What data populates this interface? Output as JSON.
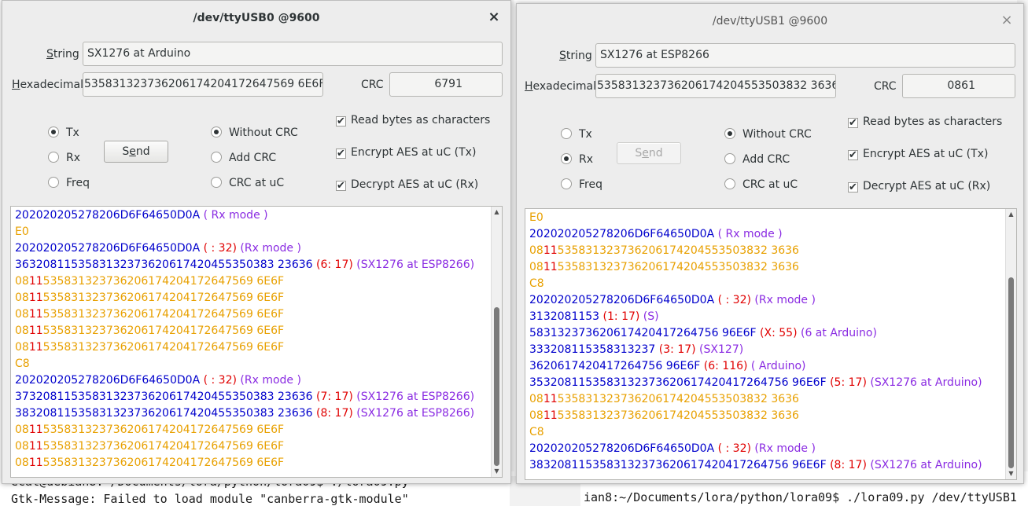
{
  "terminal": {
    "line1": "ecat@debian8:~/Documents/lora/python/lora09$ ./lora09.py",
    "line2": "Gtk-Message: Failed to load module \"canberra-gtk-module\"",
    "line3": "ian8:~/Documents/lora/python/lora09$ ./lora09.py /dev/ttyUSB1"
  },
  "windows": [
    {
      "title": "/dev/ttyUSB0 @9600",
      "close_glyph": "×",
      "string_label_u": "S",
      "string_label_rest": "tring",
      "string_value": "SX1276 at Arduino",
      "hex_label_u": "H",
      "hex_label_rest": "exadecimal",
      "hex_value": "535831323736206174204172647569 6E6F",
      "crc_label": "CRC",
      "crc_value": "6791",
      "radios_mode": [
        "Tx",
        "Rx",
        "Freq"
      ],
      "mode_selected": 0,
      "radios_crc": [
        "Without CRC",
        "Add CRC",
        "CRC at uC"
      ],
      "crc_selected": 0,
      "send_label_u": "e",
      "send_label_pre": "S",
      "send_label_post": "nd",
      "checks": [
        "Read bytes as characters",
        "Encrypt AES at uC (Tx)",
        "Decrypt AES at uC (Rx)"
      ],
      "check_glyph": "✔"
    },
    {
      "title": "/dev/ttyUSB1 @9600",
      "close_glyph": "×",
      "string_label_u": "S",
      "string_label_rest": "tring",
      "string_value": "SX1276 at ESP8266",
      "hex_label_u": "H",
      "hex_label_rest": "exadecimal",
      "hex_value": "535831323736206174204553503832 3636",
      "crc_label": "CRC",
      "crc_value": "0861",
      "radios_mode": [
        "Tx",
        "Rx",
        "Freq"
      ],
      "mode_selected": 1,
      "radios_crc": [
        "Without CRC",
        "Add CRC",
        "CRC at uC"
      ],
      "crc_selected": 0,
      "send_label_u": "e",
      "send_label_pre": "S",
      "send_label_post": "nd",
      "checks": [
        "Read bytes as characters",
        "Encrypt AES at uC (Tx)",
        "Decrypt AES at uC (Rx)"
      ],
      "check_glyph": "✔"
    }
  ],
  "log1": [
    [
      [
        "blue",
        "202020205278206D6F64650D0A"
      ],
      [
        "purple",
        " ( Rx mode )"
      ]
    ],
    [
      [
        "orange",
        "E0"
      ]
    ],
    [
      [
        "blue",
        "202020205278206D6F64650D0A"
      ],
      [
        "red",
        " ( : 32)"
      ],
      [
        "purple",
        " (Rx mode )"
      ]
    ],
    [
      [
        "blue",
        "3632081153583132373620617420455350383 23636"
      ],
      [
        "red",
        " (6: 17)"
      ],
      [
        "purple",
        " (SX1276 at ESP8266)"
      ]
    ],
    [
      [
        "orange",
        "08"
      ],
      [
        "red",
        "11"
      ],
      [
        "orange",
        "535831323736206174204172647569 6E6F"
      ]
    ],
    [
      [
        "orange",
        "08"
      ],
      [
        "red",
        "11"
      ],
      [
        "orange",
        "535831323736206174204172647569 6E6F"
      ]
    ],
    [
      [
        "orange",
        "08"
      ],
      [
        "red",
        "11"
      ],
      [
        "orange",
        "535831323736206174204172647569 6E6F"
      ]
    ],
    [
      [
        "orange",
        "08"
      ],
      [
        "red",
        "11"
      ],
      [
        "orange",
        "535831323736206174204172647569 6E6F"
      ]
    ],
    [
      [
        "orange",
        "08"
      ],
      [
        "red",
        "11"
      ],
      [
        "orange",
        "535831323736206174204172647569 6E6F"
      ]
    ],
    [
      [
        "orange",
        "C8"
      ]
    ],
    [
      [
        "blue",
        "202020205278206D6F64650D0A"
      ],
      [
        "red",
        " ( : 32)"
      ],
      [
        "purple",
        " (Rx mode )"
      ]
    ],
    [
      [
        "blue",
        "3732081153583132373620617420455350383 23636"
      ],
      [
        "red",
        " (7: 17)"
      ],
      [
        "purple",
        " (SX1276 at ESP8266)"
      ]
    ],
    [
      [
        "blue",
        "3832081153583132373620617420455350383 23636"
      ],
      [
        "red",
        " (8: 17)"
      ],
      [
        "purple",
        " (SX1276 at ESP8266)"
      ]
    ],
    [
      [
        "orange",
        "08"
      ],
      [
        "red",
        "11"
      ],
      [
        "orange",
        "535831323736206174204172647569 6E6F"
      ]
    ],
    [
      [
        "orange",
        "08"
      ],
      [
        "red",
        "11"
      ],
      [
        "orange",
        "535831323736206174204172647569 6E6F"
      ]
    ],
    [
      [
        "orange",
        "08"
      ],
      [
        "red",
        "11"
      ],
      [
        "orange",
        "535831323736206174204172647569 6E6F"
      ]
    ]
  ],
  "log2": [
    [
      [
        "orange",
        "E0"
      ]
    ],
    [
      [
        "blue",
        "202020205278206D6F64650D0A"
      ],
      [
        "purple",
        " ( Rx mode )"
      ]
    ],
    [
      [
        "orange",
        "08"
      ],
      [
        "red",
        "11"
      ],
      [
        "orange",
        "535831323736206174204553503832 3636"
      ]
    ],
    [
      [
        "orange",
        "08"
      ],
      [
        "red",
        "11"
      ],
      [
        "orange",
        "535831323736206174204553503832 3636"
      ]
    ],
    [
      [
        "orange",
        "C8"
      ]
    ],
    [
      [
        "blue",
        "202020205278206D6F64650D0A"
      ],
      [
        "red",
        " ( : 32)"
      ],
      [
        "purple",
        " (Rx mode )"
      ]
    ],
    [
      [
        "blue",
        "3132081153"
      ],
      [
        "red",
        " (1: 17)"
      ],
      [
        "purple",
        " (S)"
      ]
    ],
    [
      [
        "blue",
        "583132373620617420417264756 96E6F"
      ],
      [
        "red",
        " (X: 55)"
      ],
      [
        "purple",
        " (6 at Arduino)"
      ]
    ],
    [
      [
        "blue",
        "333208115358313237"
      ],
      [
        "red",
        " (3: 17)"
      ],
      [
        "purple",
        " (SX127)"
      ]
    ],
    [
      [
        "blue",
        "3620617420417264756 96E6F"
      ],
      [
        "red",
        " (6: 116)"
      ],
      [
        "purple",
        " ( Arduino)"
      ]
    ],
    [
      [
        "blue",
        "3532081153583132373620617420417264756 96E6F"
      ],
      [
        "red",
        " (5: 17)"
      ],
      [
        "purple",
        " (SX1276 at Arduino)"
      ]
    ],
    [
      [
        "orange",
        "08"
      ],
      [
        "red",
        "11"
      ],
      [
        "orange",
        "535831323736206174204553503832 3636"
      ]
    ],
    [
      [
        "orange",
        "08"
      ],
      [
        "red",
        "11"
      ],
      [
        "orange",
        "535831323736206174204553503832 3636"
      ]
    ],
    [
      [
        "orange",
        "C8"
      ]
    ],
    [
      [
        "blue",
        "202020205278206D6F64650D0A"
      ],
      [
        "red",
        " ( : 32)"
      ],
      [
        "purple",
        " (Rx mode )"
      ]
    ],
    [
      [
        "blue",
        "3832081153583132373620617420417264756 96E6F"
      ],
      [
        "red",
        " (8: 17)"
      ],
      [
        "purple",
        " (SX1276 at Arduino)"
      ]
    ]
  ],
  "scroll": {
    "up_glyph": "▲",
    "down_glyph": "▼",
    "log1_fraction": 0.64,
    "log2_fraction": 0.77
  },
  "colors": {
    "blue": "#0000cc",
    "red": "#e00000",
    "purple": "#8a2be2",
    "orange": "#e8a000"
  }
}
